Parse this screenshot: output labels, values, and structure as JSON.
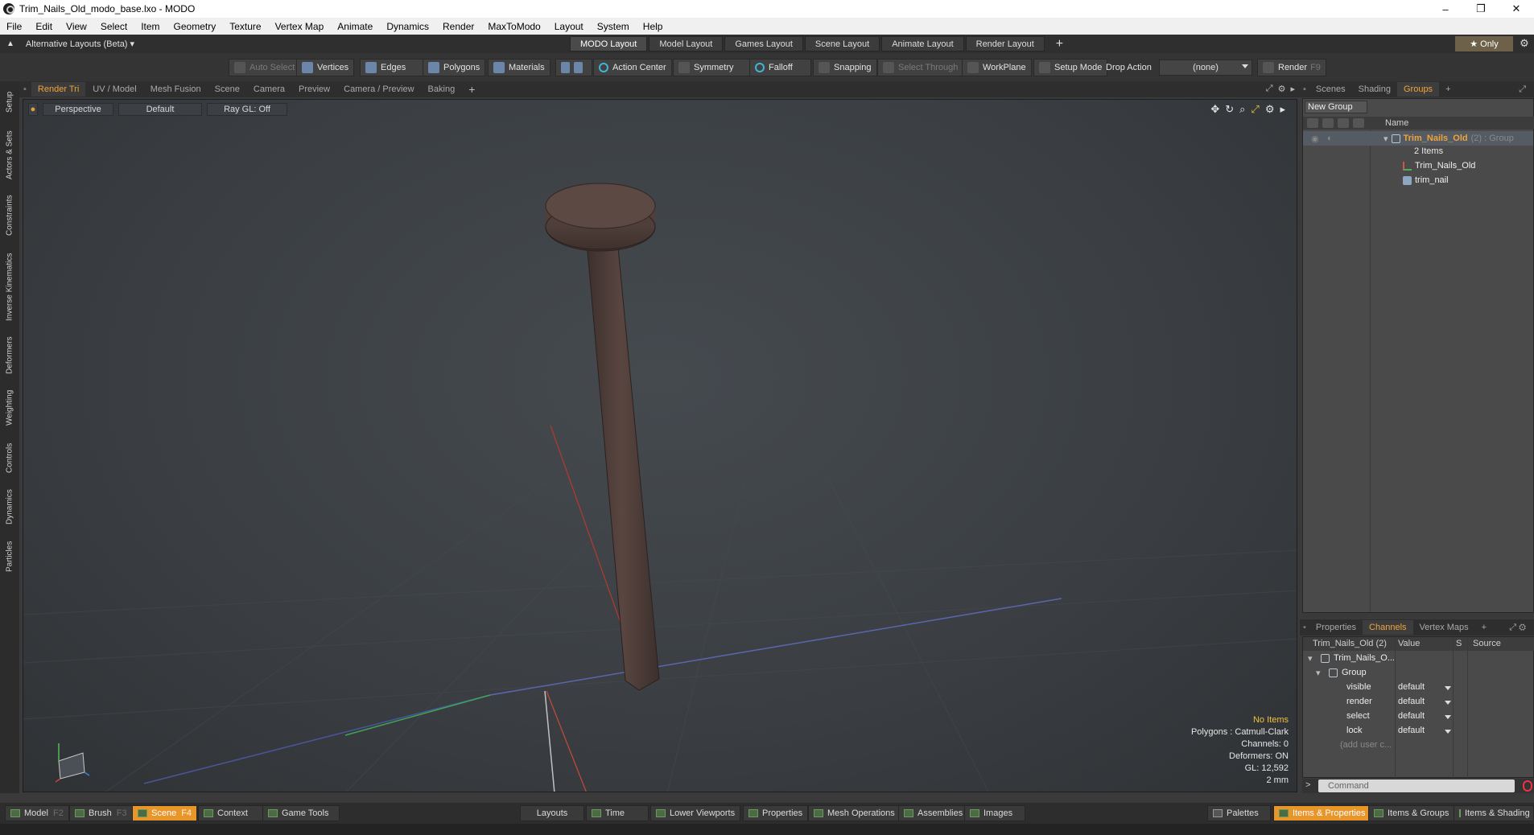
{
  "window": {
    "title": "Trim_Nails_Old_modo_base.lxo - MODO",
    "controls": [
      "–",
      "❐",
      "✕"
    ]
  },
  "menu": [
    "File",
    "Edit",
    "View",
    "Select",
    "Item",
    "Geometry",
    "Texture",
    "Vertex Map",
    "Animate",
    "Dynamics",
    "Render",
    "MaxToModo",
    "Layout",
    "System",
    "Help"
  ],
  "layoutbar": {
    "alt_layouts": "Alternative Layouts (Beta) ▾",
    "tabs": [
      "MODO Layout",
      "Model Layout",
      "Games Layout",
      "Scene Layout",
      "Animate Layout",
      "Render Layout"
    ],
    "plus": "+",
    "only": "★  Only"
  },
  "toolbar": {
    "auto_select": "Auto Select",
    "vertices": "Vertices",
    "edges": "Edges",
    "polygons": "Polygons",
    "materials": "Materials",
    "action_center": "Action Center",
    "symmetry": "Symmetry",
    "falloff": "Falloff",
    "snapping": "Snapping",
    "select_through": "Select Through",
    "workplane": "WorkPlane",
    "setup_mode": "Setup Mode",
    "drop_action": "Drop Action",
    "drop_value": "(none)",
    "render": "Render",
    "render_key": "F9"
  },
  "left_tabs": [
    "Setup",
    "Actors & Sets",
    "Constraints",
    "Inverse Kinematics",
    "Deformers",
    "Weighting",
    "Controls",
    "Dynamics",
    "Particles"
  ],
  "viewport_tabs": [
    "Render Tri",
    "UV / Model",
    "Mesh Fusion",
    "Scene",
    "Camera",
    "Preview",
    "Camera / Preview",
    "Baking",
    "+"
  ],
  "viewport": {
    "view": "Perspective",
    "shading": "Default",
    "raygl": "Ray GL: Off",
    "info": {
      "items": "No Items",
      "polygons": "Polygons : Catmull-Clark",
      "channels": "Channels: 0",
      "deformers": "Deformers: ON",
      "gl": "GL: 12,592",
      "scale": "2 mm"
    }
  },
  "right_tabs": [
    "Scenes",
    "Shading",
    "Groups",
    "+"
  ],
  "groups": {
    "new_group": "New Group",
    "name_header": "Name",
    "group_name": "Trim_Nails_Old",
    "group_suffix": "(2) : Group",
    "items_count": "2 Items",
    "children": [
      "Trim_Nails_Old",
      "trim_nail"
    ]
  },
  "props_tabs": [
    "Properties",
    "Channels",
    "Vertex Maps",
    "+"
  ],
  "channels": {
    "header_item": "Trim_Nails_Old (2)",
    "header_value": "Value",
    "header_s": "S",
    "header_source": "Source",
    "root": "Trim_Nails_O...",
    "group": "Group",
    "rows": [
      {
        "name": "visible",
        "value": "default"
      },
      {
        "name": "render",
        "value": "default"
      },
      {
        "name": "select",
        "value": "default"
      },
      {
        "name": "lock",
        "value": "default"
      }
    ],
    "add_user": "(add user c..."
  },
  "command": {
    "placeholder": "Command",
    "arrow": ">"
  },
  "bottombar": {
    "model": "Model",
    "model_key": "F2",
    "brush": "Brush",
    "brush_key": "F3",
    "scene": "Scene",
    "scene_key": "F4",
    "context": "Context",
    "game_tools": "Game Tools",
    "layouts": "Layouts",
    "time": "Time",
    "lower_viewports": "Lower Viewports",
    "properties": "Properties",
    "mesh_operations": "Mesh Operations",
    "assemblies": "Assemblies",
    "images": "Images",
    "palettes": "Palettes",
    "items_properties": "Items & Properties",
    "items_groups": "Items & Groups",
    "items_shading": "Items & Shading"
  },
  "colors": {
    "accent": "#f0a33a",
    "active_tab": "#e8952a"
  }
}
